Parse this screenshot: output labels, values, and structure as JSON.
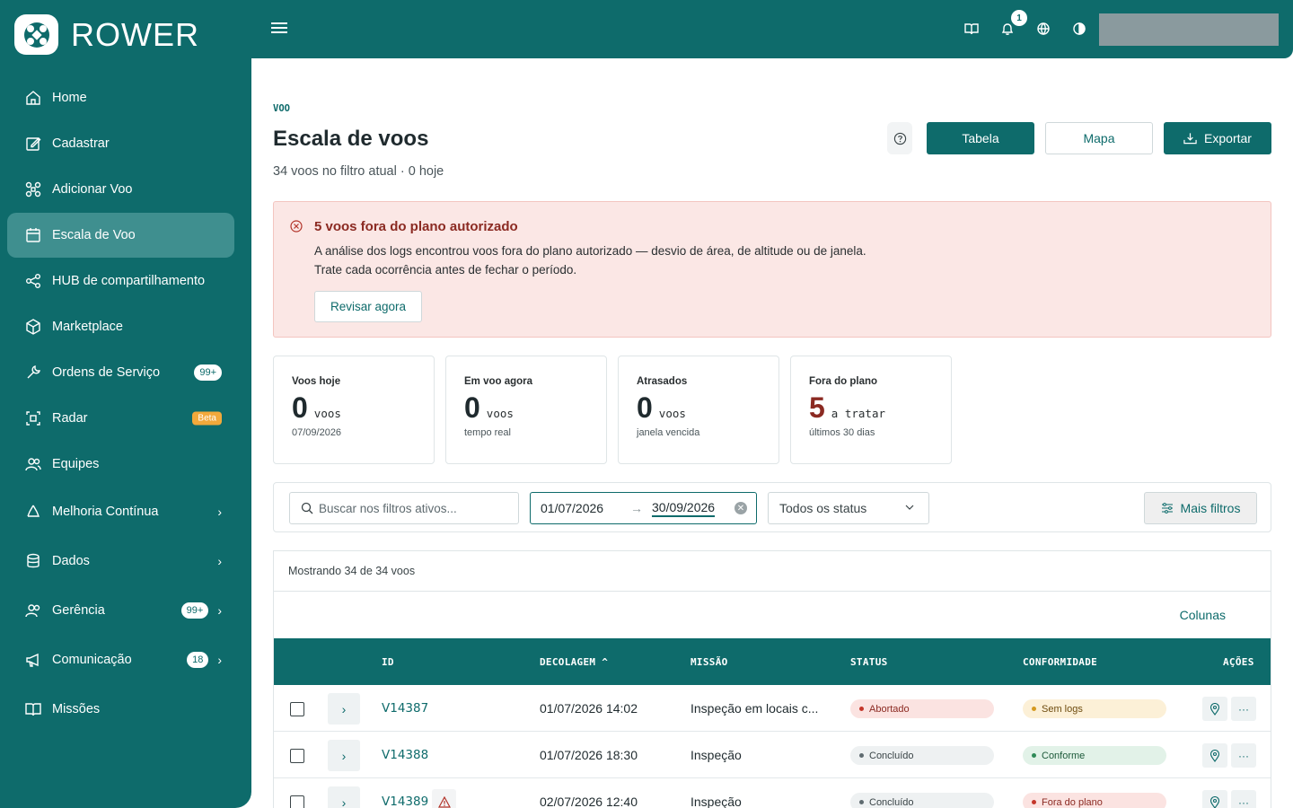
{
  "brand": {
    "name": "ROWER"
  },
  "sidebar": {
    "items": [
      {
        "label": "Home",
        "icon": "home-icon"
      },
      {
        "label": "Cadastrar",
        "icon": "edit-icon"
      },
      {
        "label": "Adicionar Voo",
        "icon": "drone-icon"
      },
      {
        "label": "Escala de Voo",
        "icon": "calendar-icon",
        "active": true
      },
      {
        "label": "HUB de compartilhamento",
        "icon": "share-icon"
      },
      {
        "label": "Marketplace",
        "icon": "box-icon"
      },
      {
        "label": "Ordens de Serviço",
        "icon": "wrench-icon",
        "badge": "99+"
      },
      {
        "label": "Radar",
        "icon": "radar-icon",
        "beta": "Beta"
      },
      {
        "label": "Equipes",
        "icon": "users-icon"
      },
      {
        "label": "Melhoria Contínua",
        "icon": "recycle-icon",
        "chevron": true
      },
      {
        "label": "Dados",
        "icon": "database-icon",
        "chevron": true
      },
      {
        "label": "Gerência",
        "icon": "team-icon",
        "badge": "99+",
        "chevron": true
      },
      {
        "label": "Comunicação",
        "icon": "megaphone-icon",
        "badge": "18",
        "chevron": true
      },
      {
        "label": "Missões",
        "icon": "book-icon"
      }
    ]
  },
  "topbar": {
    "notifications_count": "1",
    "icons": [
      "book-icon",
      "bell-icon",
      "globe-icon",
      "contrast-icon"
    ]
  },
  "page": {
    "eyebrow": "VOO",
    "title": "Escala de voos",
    "subtitle": "34 voos no filtro atual · 0 hoje",
    "buttons": {
      "table": "Tabela",
      "map": "Mapa",
      "export": "Exportar"
    }
  },
  "alert": {
    "title": "5 voos fora do plano autorizado",
    "text": "A análise dos logs encontrou voos fora do plano autorizado — desvio de área, de altitude ou de janela. Trate cada ocorrência antes de fechar o período.",
    "action": "Revisar agora"
  },
  "stats": [
    {
      "label": "Voos hoje",
      "value": "0",
      "unit": "voos",
      "sub": "07/09/2026"
    },
    {
      "label": "Em voo agora",
      "value": "0",
      "unit": "voos",
      "sub": "tempo real"
    },
    {
      "label": "Atrasados",
      "value": "0",
      "unit": "voos",
      "sub": "janela vencida"
    },
    {
      "label": "Fora do plano",
      "value": "5",
      "unit": "a tratar",
      "sub": "últimos 30 dias"
    }
  ],
  "filters": {
    "search_placeholder": "Buscar nos filtros ativos...",
    "date_start": "01/07/2026",
    "date_end": "30/09/2026",
    "status": "Todos os status",
    "more": "Mais filtros"
  },
  "table": {
    "showing": "Mostrando 34 de 34 voos",
    "columns_link": "Colunas",
    "headers": {
      "id": "ID",
      "takeoff": "DECOLAGEM",
      "mission": "MISSÃO",
      "status": "STATUS",
      "compliance": "CONFORMIDADE",
      "actions": "AÇÕES"
    },
    "rows": [
      {
        "id": "V14387",
        "takeoff": "01/07/2026 14:02",
        "mission": "Inspeção em locais c...",
        "status": "Abortado",
        "compliance": "Sem logs",
        "warn": false
      },
      {
        "id": "V14388",
        "takeoff": "01/07/2026 18:30",
        "mission": "Inspeção",
        "status": "Concluído",
        "compliance": "Conforme",
        "warn": false
      },
      {
        "id": "V14389",
        "takeoff": "02/07/2026 12:40",
        "mission": "Inspeção",
        "status": "Concluído",
        "compliance": "Fora do plano",
        "warn": true
      }
    ]
  },
  "colors": {
    "primary": "#0e6b6b",
    "danger_bg": "#fbe7e5",
    "danger_text": "#8b2a22"
  }
}
